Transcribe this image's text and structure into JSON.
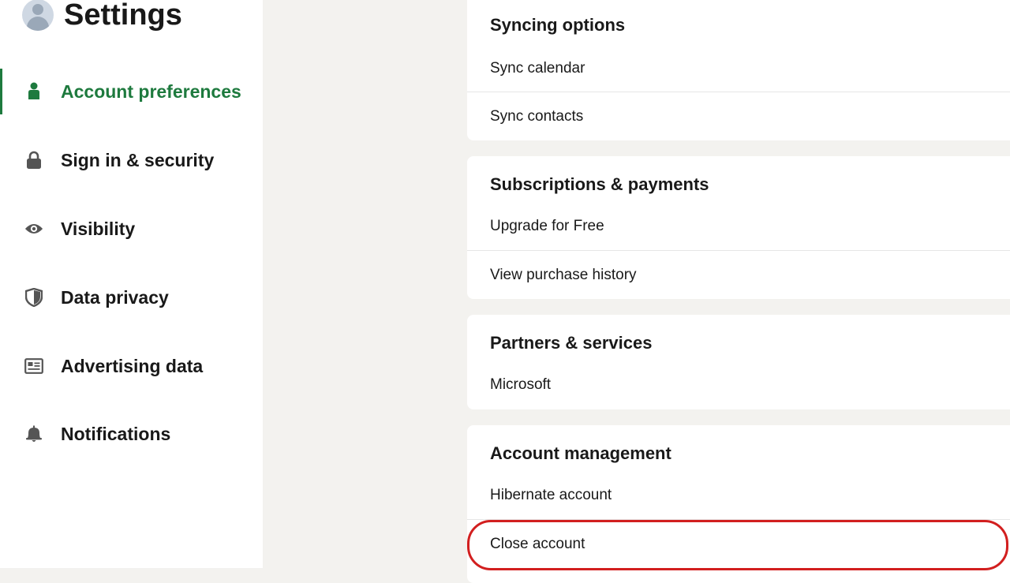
{
  "header": {
    "title": "Settings"
  },
  "sidebar": {
    "items": [
      {
        "label": "Account preferences",
        "icon": "person-icon",
        "active": true
      },
      {
        "label": "Sign in & security",
        "icon": "lock-icon"
      },
      {
        "label": "Visibility",
        "icon": "eye-icon"
      },
      {
        "label": "Data privacy",
        "icon": "shield-icon"
      },
      {
        "label": "Advertising data",
        "icon": "newspaper-icon"
      },
      {
        "label": "Notifications",
        "icon": "bell-icon"
      }
    ]
  },
  "main": {
    "sections": [
      {
        "title": "Syncing options",
        "rows": [
          "Sync calendar",
          "Sync contacts"
        ]
      },
      {
        "title": "Subscriptions & payments",
        "rows": [
          "Upgrade for Free",
          "View purchase history"
        ]
      },
      {
        "title": "Partners & services",
        "rows": [
          "Microsoft"
        ]
      },
      {
        "title": "Account management",
        "rows": [
          "Hibernate account",
          "Close account"
        ]
      }
    ]
  },
  "colors": {
    "accent": "#1e7a3e",
    "highlight": "#d21f1f",
    "background": "#f3f2ef"
  }
}
